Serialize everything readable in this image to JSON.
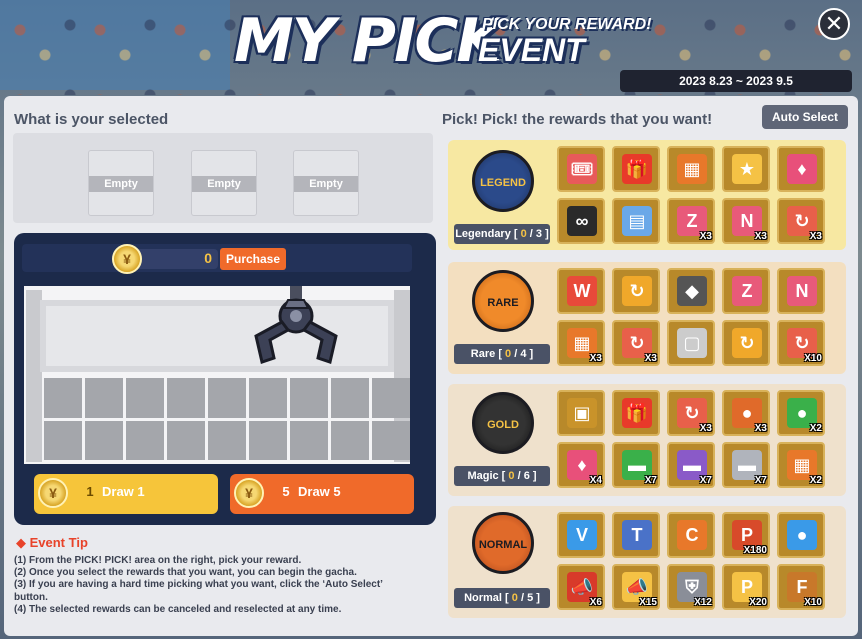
{
  "header": {
    "title": "MY PICK",
    "subtitle_top": "PICK YOUR REWARD!",
    "subtitle_bottom": "EVENT",
    "date_range": "2023 8.23 ~ 2023 9.5"
  },
  "left": {
    "title": "What is your selected",
    "slots": [
      "Empty",
      "Empty",
      "Empty"
    ],
    "coin_count": "0",
    "purchase_label": "Purchase",
    "draw1": {
      "count": "1",
      "label": "Draw 1"
    },
    "draw5": {
      "count": "5",
      "label": "Draw 5"
    },
    "tip_title": "◆ Event Tip",
    "tips": [
      "(1) From the PICK! PICK! area on the right, pick your reward.",
      "(2) Once you select the rewards that you want, you can begin the gacha.",
      "(3) If you are having a hard time picking what you want, click the ‘Auto Select’",
      "button.",
      "(4) The selected rewards can be canceled and reselected at any time."
    ]
  },
  "right": {
    "title": "Pick! Pick! the rewards that you want!",
    "auto_select": "Auto Select",
    "tiers": [
      {
        "name": "LEGEND",
        "label": "Legendary",
        "picked": "0",
        "total": "3"
      },
      {
        "name": "RARE",
        "label": "Rare",
        "picked": "0",
        "total": "4"
      },
      {
        "name": "GOLD",
        "label": "Magic",
        "picked": "0",
        "total": "6"
      },
      {
        "name": "NORMAL",
        "label": "Normal",
        "picked": "0",
        "total": "5"
      }
    ],
    "legend_rewards": [
      {
        "icon": "ticket-icon",
        "qty": ""
      },
      {
        "icon": "giftbox-icon",
        "qty": ""
      },
      {
        "icon": "card-pack-icon",
        "qty": ""
      },
      {
        "icon": "star-badge-icon",
        "qty": ""
      },
      {
        "icon": "card-icon",
        "qty": ""
      },
      {
        "icon": "glasses-icon",
        "qty": ""
      },
      {
        "icon": "card-pack-blue-icon",
        "qty": ""
      },
      {
        "icon": "card-z-icon",
        "qty": "X3"
      },
      {
        "icon": "card-n-icon",
        "qty": "X3"
      },
      {
        "icon": "card-refresh-icon",
        "qty": "X3"
      }
    ],
    "rare_rewards": [
      {
        "icon": "card-wow-icon",
        "qty": ""
      },
      {
        "icon": "refresh-box-icon",
        "qty": ""
      },
      {
        "icon": "gem-icon",
        "qty": ""
      },
      {
        "icon": "card-z-icon",
        "qty": ""
      },
      {
        "icon": "card-n-icon",
        "qty": ""
      },
      {
        "icon": "card-pack-icon",
        "qty": "X3"
      },
      {
        "icon": "card-refresh-icon",
        "qty": "X3"
      },
      {
        "icon": "mystery-box-icon",
        "qty": ""
      },
      {
        "icon": "refresh-box-icon",
        "qty": ""
      },
      {
        "icon": "card-refresh-icon",
        "qty": "X10"
      }
    ],
    "magic_rewards": [
      {
        "icon": "chest-icon",
        "qty": ""
      },
      {
        "icon": "giftbox-icon",
        "qty": ""
      },
      {
        "icon": "card-refresh-icon",
        "qty": "X3"
      },
      {
        "icon": "basketball-icon",
        "qty": "X3"
      },
      {
        "icon": "green-ball-icon",
        "qty": "X2"
      },
      {
        "icon": "card-icon",
        "qty": "X4"
      },
      {
        "icon": "green-card-icon",
        "qty": "X7"
      },
      {
        "icon": "purple-card-icon",
        "qty": "X7"
      },
      {
        "icon": "silver-card-icon",
        "qty": "X7"
      },
      {
        "icon": "card-pack-icon",
        "qty": "X2"
      }
    ],
    "normal_rewards": [
      {
        "icon": "vip-icon",
        "qty": ""
      },
      {
        "icon": "training-reset-icon",
        "qty": ""
      },
      {
        "icon": "character-name-icon",
        "qty": ""
      },
      {
        "icon": "point-sponsor-icon",
        "qty": "X180"
      },
      {
        "icon": "blue-ball-icon",
        "qty": ""
      },
      {
        "icon": "megaphone-icon",
        "qty": "X6"
      },
      {
        "icon": "megaphone-gold-icon",
        "qty": "X15"
      },
      {
        "icon": "shield-icon",
        "qty": "X12"
      },
      {
        "icon": "point-icon",
        "qty": "X20"
      },
      {
        "icon": "free-style-icon",
        "qty": "X10"
      }
    ]
  }
}
